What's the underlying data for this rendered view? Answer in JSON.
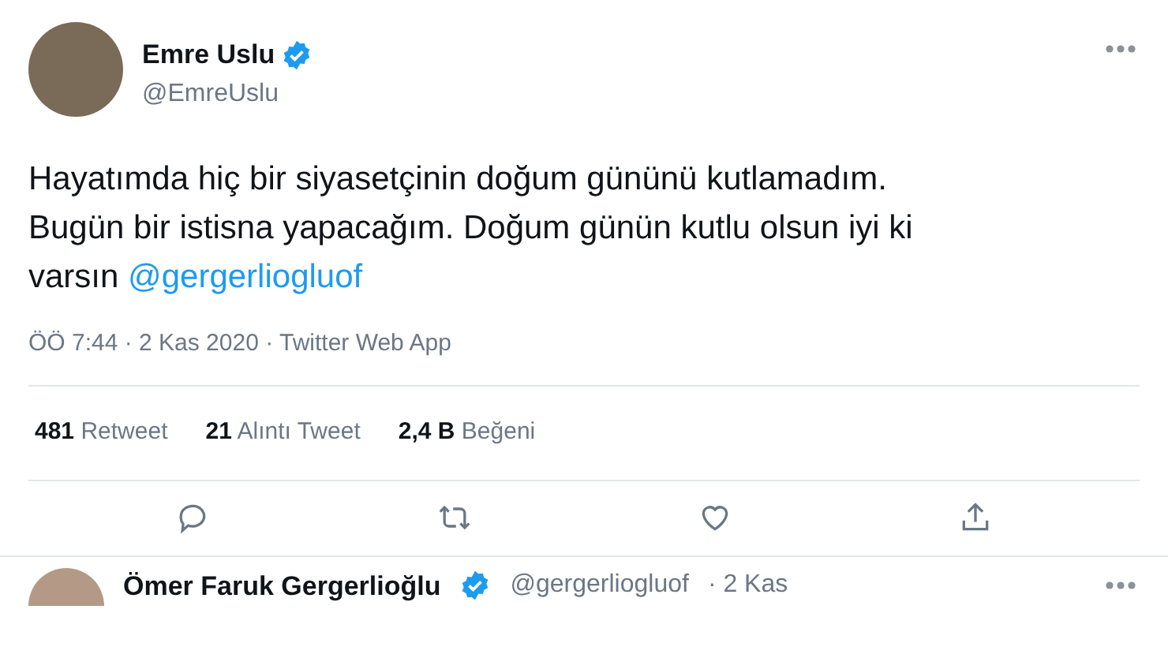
{
  "tweet": {
    "name": "Emre Uslu",
    "verified": true,
    "handle": "@EmreUslu",
    "text": "Hayatımda hiç bir siyasetçinin doğum gününü kutlamadım. Bugün bir istisna yapacağım. Doğum günün kutlu olsun iyi ki varsın",
    "mention": "@gergerliogluof",
    "meta": "ÖÖ 7:44 · 2 Kas 2020 · Twitter Web App",
    "stats": [
      {
        "count": "481",
        "label": "Retweet"
      },
      {
        "count": "21",
        "label": "Alıntı Tweet"
      },
      {
        "count": "2,4 B",
        "label": "Beğeni"
      }
    ]
  },
  "reply": {
    "name": "Ömer Faruk Gergerlioğlu",
    "verified": true,
    "handle": "@gergerliogluof",
    "time": "· 2 Kas"
  }
}
